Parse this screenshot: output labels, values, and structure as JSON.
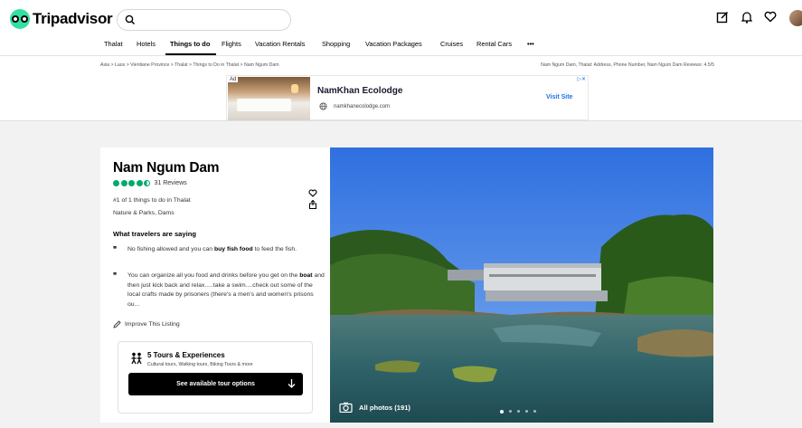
{
  "brand": {
    "name": "Tripadvisor",
    "accent": "#34e0a1"
  },
  "search": {
    "placeholder": ""
  },
  "nav": {
    "items": [
      "Thalat",
      "Hotels",
      "Things to do",
      "Flights",
      "Vacation Rentals",
      "Shopping",
      "Vacation Packages",
      "Cruises",
      "Rental Cars",
      "•••"
    ],
    "active": "Things to do"
  },
  "breadcrumb": {
    "trail": "Asia > Laos > Vientiane Province > Thalat > Things to Do in Thalat > Nam Ngum Dam",
    "right": "Nam Ngum Dam, Thalat: Address, Phone Number, Nam Ngum Dam Reviews: 4.5/5"
  },
  "ad": {
    "badge": "Ad",
    "title": "NamKhan Ecolodge",
    "domain": "namkhanecolodge.com",
    "cta": "Visit Site"
  },
  "attraction": {
    "name": "Nam Ngum Dam",
    "rating": 4.5,
    "reviews": "31 Reviews",
    "rank": "#1 of 1 things to do in Thalat",
    "category": "Nature & Parks, Dams",
    "saying_title": "What travelers are saying",
    "quotes": [
      {
        "pre": "No fishing allowed and you can ",
        "bold": "buy fish food",
        "post": " to feed the fish."
      },
      {
        "pre": "You can organize all you food and drinks before you get on the ",
        "bold": "boat",
        "post": " and then just kick back and relax.....take a swim....check out some of the local crafts made by prisoners (there's a men's and women's prisons ou..."
      }
    ],
    "improve": "Improve This Listing"
  },
  "tours": {
    "title": "5 Tours & Experiences",
    "subtitle": "Cultural tours, Walking tours, Biking Tours & more",
    "button": "See available tour options"
  },
  "photo": {
    "label": "All photos (191)",
    "dots_total": 5,
    "dots_active": 1
  }
}
